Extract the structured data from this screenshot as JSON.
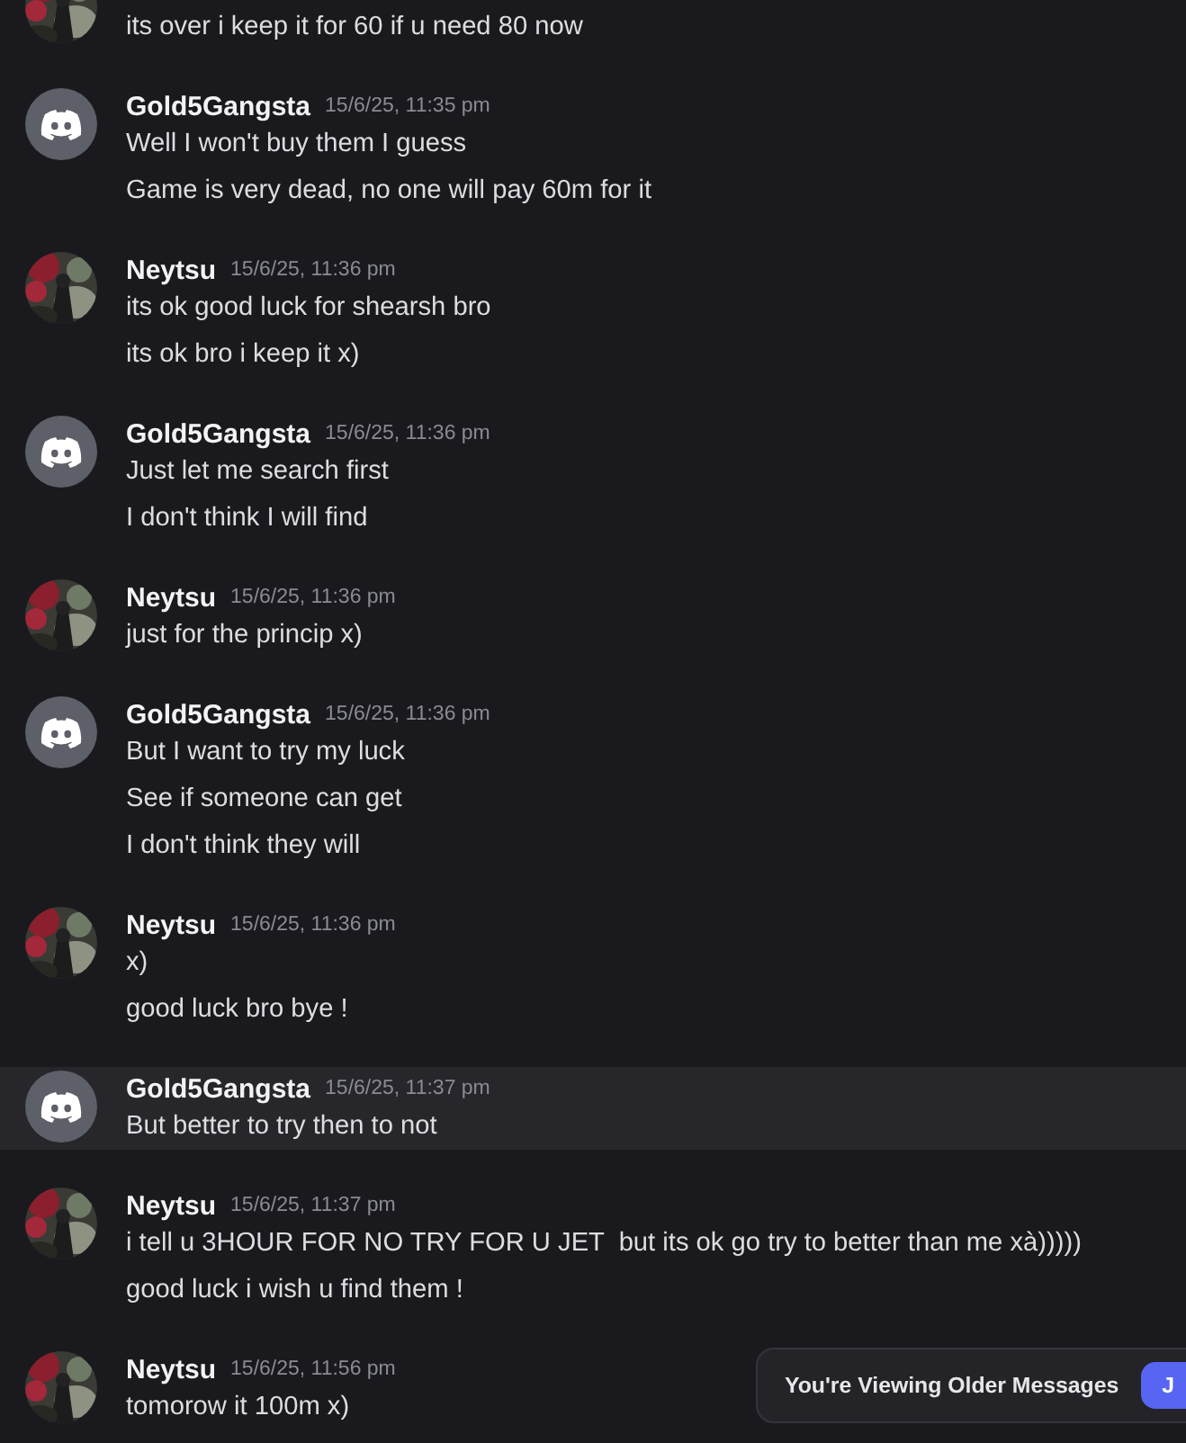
{
  "messages": [
    {
      "kind": "picture",
      "highlighted": false,
      "lines": [
        "its over i keep it for 60 if u need 80 now"
      ]
    },
    {
      "kind": "logo",
      "author": "Gold5Gangsta",
      "time": "15/6/25, 11:35 pm",
      "highlighted": false,
      "lines": [
        "Well I won't buy them I guess",
        "Game is very dead, no one will pay 60m for it"
      ]
    },
    {
      "kind": "picture",
      "author": "Neytsu",
      "time": "15/6/25, 11:36 pm",
      "highlighted": false,
      "lines": [
        "its ok good luck for shearsh bro",
        "its ok bro i keep it x)"
      ]
    },
    {
      "kind": "logo",
      "author": "Gold5Gangsta",
      "time": "15/6/25, 11:36 pm",
      "highlighted": false,
      "lines": [
        "Just let me search first",
        "I don't think I will find"
      ]
    },
    {
      "kind": "picture",
      "author": "Neytsu",
      "time": "15/6/25, 11:36 pm",
      "highlighted": false,
      "lines": [
        "just for the princip x)"
      ]
    },
    {
      "kind": "logo",
      "author": "Gold5Gangsta",
      "time": "15/6/25, 11:36 pm",
      "highlighted": false,
      "lines": [
        "But I want to try my luck",
        "See if someone can get",
        "I don't think they will"
      ]
    },
    {
      "kind": "picture",
      "author": "Neytsu",
      "time": "15/6/25, 11:36 pm",
      "highlighted": false,
      "lines": [
        "x)",
        "good luck bro bye !"
      ]
    },
    {
      "kind": "logo",
      "author": "Gold5Gangsta",
      "time": "15/6/25, 11:37 pm",
      "highlighted": true,
      "lines": [
        "But better to try then to not"
      ]
    },
    {
      "kind": "picture",
      "author": "Neytsu",
      "time": "15/6/25, 11:37 pm",
      "highlighted": false,
      "lines": [
        "i tell u 3HOUR FOR NO TRY FOR U JET  but its ok go try to better than me xà)))))",
        "good luck i wish u find them !"
      ]
    },
    {
      "kind": "picture",
      "author": "Neytsu",
      "time": "15/6/25, 11:56 pm",
      "highlighted": false,
      "lines": [
        "tomorow it 100m x)"
      ]
    }
  ],
  "older_bar": {
    "text": "You're Viewing Older Messages",
    "button": "J"
  }
}
